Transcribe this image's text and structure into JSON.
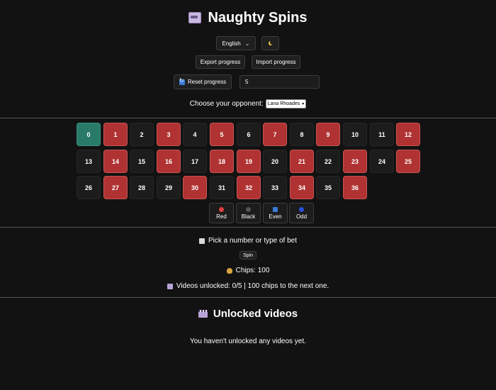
{
  "header": {
    "title": "Naughty Spins",
    "icon": "slot-machine-icon"
  },
  "controls": {
    "language": "English",
    "language_options": [
      "English"
    ],
    "theme_icon": "moon-icon",
    "export_label": "Export progress",
    "import_label": "Import progress",
    "reset_label": "Reset progress",
    "bet_value": "5",
    "opponent_label": "Choose your opponent:",
    "opponent_value": "Lana Rhoades"
  },
  "wheel": {
    "rows": [
      [
        {
          "n": "0",
          "c": "green"
        },
        {
          "n": "1",
          "c": "red"
        },
        {
          "n": "2",
          "c": "black"
        },
        {
          "n": "3",
          "c": "red"
        },
        {
          "n": "4",
          "c": "black"
        },
        {
          "n": "5",
          "c": "red"
        },
        {
          "n": "6",
          "c": "black"
        },
        {
          "n": "7",
          "c": "red"
        },
        {
          "n": "8",
          "c": "black"
        },
        {
          "n": "9",
          "c": "red"
        },
        {
          "n": "10",
          "c": "black"
        },
        {
          "n": "11",
          "c": "black"
        },
        {
          "n": "12",
          "c": "red"
        }
      ],
      [
        {
          "n": "13",
          "c": "black"
        },
        {
          "n": "14",
          "c": "red"
        },
        {
          "n": "15",
          "c": "black"
        },
        {
          "n": "16",
          "c": "red"
        },
        {
          "n": "17",
          "c": "black"
        },
        {
          "n": "18",
          "c": "red"
        },
        {
          "n": "19",
          "c": "red"
        },
        {
          "n": "20",
          "c": "black"
        },
        {
          "n": "21",
          "c": "red"
        },
        {
          "n": "22",
          "c": "black"
        },
        {
          "n": "23",
          "c": "red"
        },
        {
          "n": "24",
          "c": "black"
        },
        {
          "n": "25",
          "c": "red"
        }
      ],
      [
        {
          "n": "26",
          "c": "black"
        },
        {
          "n": "27",
          "c": "red"
        },
        {
          "n": "28",
          "c": "black"
        },
        {
          "n": "29",
          "c": "black"
        },
        {
          "n": "30",
          "c": "red"
        },
        {
          "n": "31",
          "c": "black"
        },
        {
          "n": "32",
          "c": "red"
        },
        {
          "n": "33",
          "c": "black"
        },
        {
          "n": "34",
          "c": "red"
        },
        {
          "n": "35",
          "c": "black"
        },
        {
          "n": "36",
          "c": "red"
        }
      ]
    ],
    "bet_types": [
      {
        "label": "Red",
        "icon": "red-circle-icon"
      },
      {
        "label": "Black",
        "icon": "black-circle-icon"
      },
      {
        "label": "Even",
        "icon": "even-icon"
      },
      {
        "label": "Odd",
        "icon": "blue-circle-icon"
      }
    ]
  },
  "status": {
    "prompt": "Pick a number or type of bet",
    "spin_label": "Spin",
    "chips": "Chips: 100",
    "videos": "Videos unlocked: 0/5 | 100 chips to the next one."
  },
  "videos": {
    "title": "Unlocked videos",
    "empty": "You haven't unlocked any videos yet."
  },
  "colors": {
    "background": "#121212",
    "red": "#b03232",
    "black": "#1c1c1c",
    "green": "#2a7a6a"
  }
}
